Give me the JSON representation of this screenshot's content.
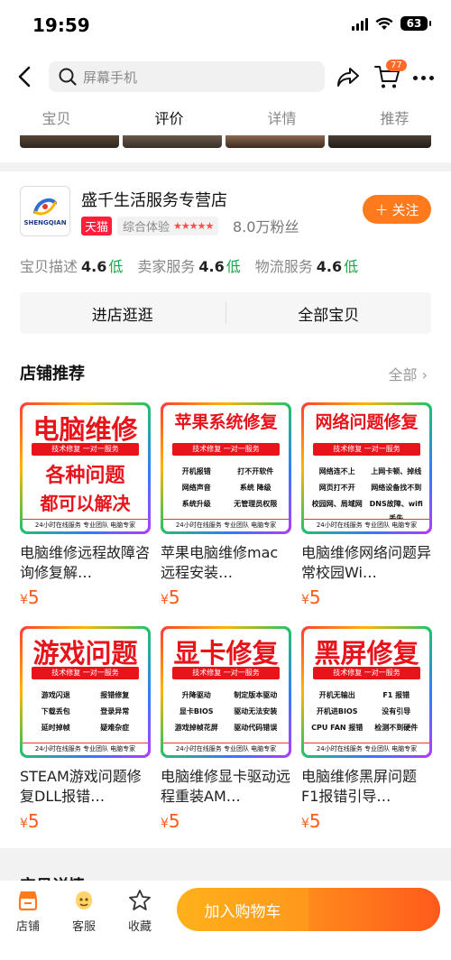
{
  "status_bar": {
    "time": "19:59",
    "battery": "63"
  },
  "topbar": {
    "search_placeholder": "屏幕手机",
    "cart_count": "77"
  },
  "tabs": [
    {
      "label": "宝贝",
      "active": false
    },
    {
      "label": "评价",
      "active": true
    },
    {
      "label": "详情",
      "active": false
    },
    {
      "label": "推荐",
      "active": false
    }
  ],
  "shop": {
    "logo_text": "SHENGQIAN",
    "name": "盛千生活服务专营店",
    "tmall_badge": "天猫",
    "rating_label": "综合体验",
    "rating_stars": "★★★★★",
    "fans": "8.0万粉丝",
    "follow_label": "关注",
    "scores": [
      {
        "label": "宝贝描述",
        "value": "4.6",
        "level": "低"
      },
      {
        "label": "卖家服务",
        "value": "4.6",
        "level": "低"
      },
      {
        "label": "物流服务",
        "value": "4.6",
        "level": "低"
      }
    ],
    "enter_shop": "进店逛逛",
    "all_items": "全部宝贝",
    "rec_title": "店铺推荐",
    "rec_all": "全部"
  },
  "products": [
    {
      "thumb_title": "电脑维修",
      "thumb_sub1": "各种问题",
      "thumb_sub2": "都可以解决",
      "thumb_bar": "技术修复 一对一服务",
      "thumb_items": [],
      "thumb_foot": "24小时在线服务 专业团队 电脑专家",
      "name": "电脑维修远程故障咨询修复解…",
      "currency": "¥",
      "price": "5"
    },
    {
      "thumb_title": "苹果系统修复",
      "thumb_sub1": "",
      "thumb_sub2": "",
      "thumb_bar": "技术修复 一对一服务",
      "thumb_items": [
        "开机报错",
        "打不开软件",
        "网络声音",
        "系统 降级",
        "系统升级",
        "无管理员权限"
      ],
      "thumb_foot": "24小时在线服务 专业团队 电脑专家",
      "name": "苹果电脑维修mac远程安装…",
      "currency": "¥",
      "price": "5"
    },
    {
      "thumb_title": "网络问题修复",
      "thumb_sub1": "",
      "thumb_sub2": "",
      "thumb_bar": "技术修复 一对一服务",
      "thumb_items": [
        "网络连不上",
        "上网卡顿、掉线",
        "网页打不开",
        "网络设备找不到",
        "校园网、局域网",
        "DNS故障、wifi丢失"
      ],
      "thumb_foot": "24小时在线服务 专业团队 电脑专家",
      "name": "电脑维修网络问题异常校园Wi…",
      "currency": "¥",
      "price": "5"
    },
    {
      "thumb_title": "游戏问题",
      "thumb_sub1": "",
      "thumb_sub2": "",
      "thumb_bar": "技术修复 一对一服务",
      "thumb_items": [
        "游戏闪退",
        "报错修复",
        "下载丢包",
        "登录异常",
        "延时掉帧",
        "疑难杂症"
      ],
      "thumb_foot": "24小时在线服务 专业团队 电脑专家",
      "name": "STEAM游戏问题修复DLL报错…",
      "currency": "¥",
      "price": "5"
    },
    {
      "thumb_title": "显卡修复",
      "thumb_sub1": "",
      "thumb_sub2": "",
      "thumb_bar": "技术修复 一对一服务",
      "thumb_items": [
        "升降驱动",
        "制定版本驱动",
        "显卡BIOS",
        "驱动无法安装",
        "游戏掉帧花屏",
        "驱动代码错误"
      ],
      "thumb_foot": "24小时在线服务 专业团队 电脑专家",
      "name": "电脑维修显卡驱动远程重装AM…",
      "currency": "¥",
      "price": "5"
    },
    {
      "thumb_title": "黑屏修复",
      "thumb_sub1": "",
      "thumb_sub2": "",
      "thumb_bar": "技术修复 一对一服务",
      "thumb_items": [
        "开机无输出",
        "F1 报错",
        "开机进BIOS",
        "没有引导",
        "CPU FAN 报错",
        "检测不到硬件"
      ],
      "thumb_foot": "24小时在线服务 专业团队 电脑专家",
      "name": "电脑维修黑屏问题F1报错引导…",
      "currency": "¥",
      "price": "5"
    }
  ],
  "detail_peek": "宝贝详情",
  "bottom": {
    "shop_label": "店铺",
    "service_label": "客服",
    "fav_label": "收藏",
    "cart_label": "加入购物车"
  },
  "colors": {
    "accent": "#ff7a1c",
    "tmall": "#ff1f3a",
    "price": "#ff5a1a",
    "score_low": "#1aa648"
  }
}
